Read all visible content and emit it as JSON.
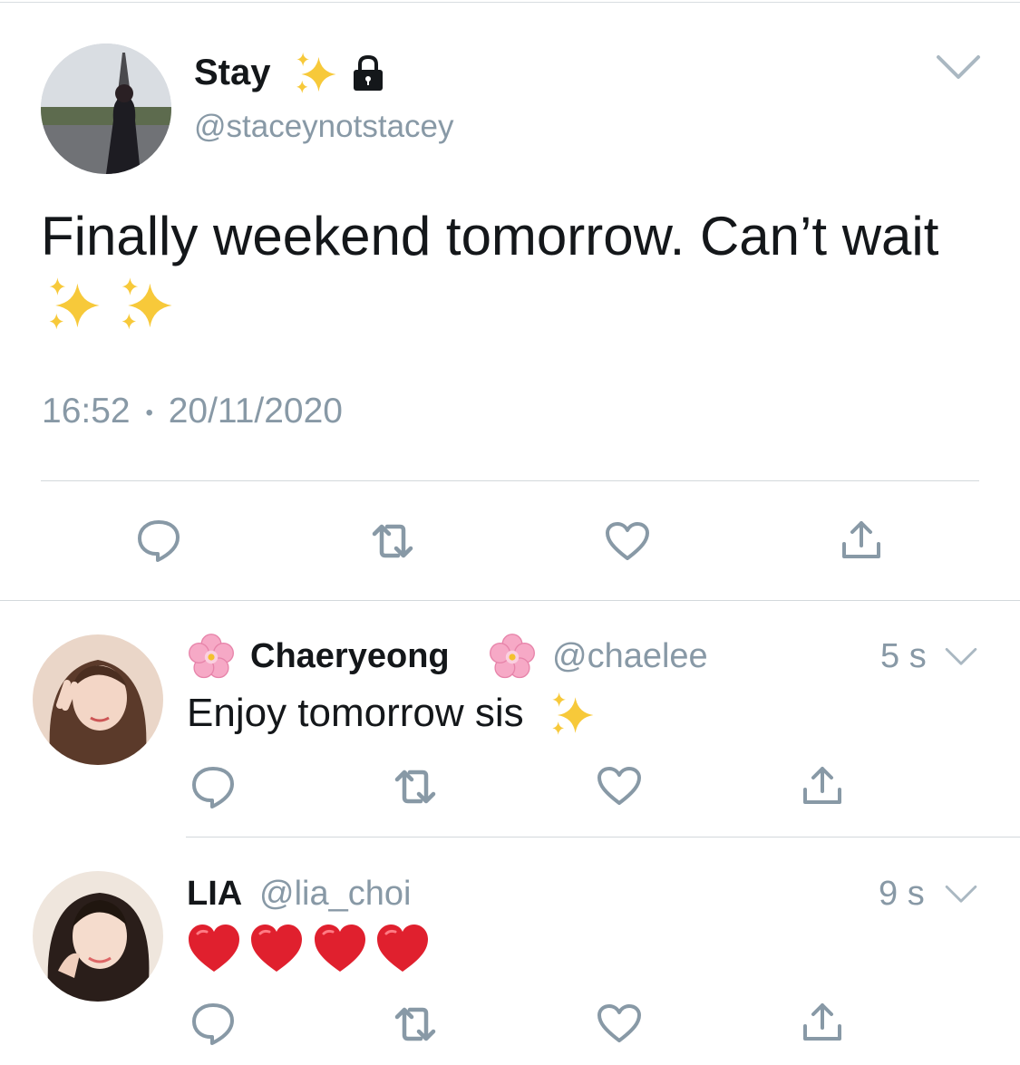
{
  "main_tweet": {
    "display_name": "Stay",
    "handle": "@staceynotstacey",
    "text_line1": "Finally weekend tomorrow. Can’t wait",
    "time": "16:52",
    "dot": "•",
    "date": "20/11/2020"
  },
  "replies": [
    {
      "display_name": "Chaeryeong",
      "handle": "@chaelee",
      "text": "Enjoy tomorrow sis",
      "age": "5 s"
    },
    {
      "display_name": "LIA",
      "handle": "@lia_choi",
      "age": "9 s"
    }
  ],
  "icons": {
    "reply": "reply-bubble-icon",
    "retweet": "retweet-icon",
    "like": "heart-icon",
    "share": "share-icon",
    "menu": "chevron-down-icon",
    "lock": "lock-icon",
    "sparkles": "sparkles-emoji",
    "flower": "cherry-blossom-emoji",
    "heart": "red-heart-emoji"
  },
  "colors": {
    "accent_grey": "#8899a6",
    "heart_red": "#e0202e",
    "sparkle_yellow": "#f7c93a"
  }
}
